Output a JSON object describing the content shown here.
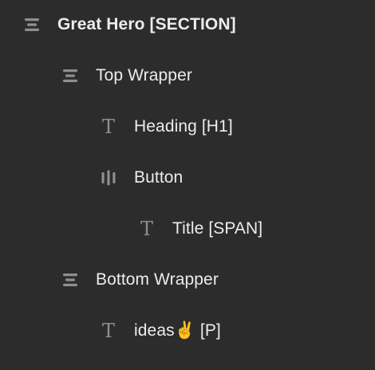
{
  "tree": {
    "items": [
      {
        "label": "Great Hero [SECTION]",
        "icon": "section-stack-icon",
        "level": 0
      },
      {
        "label": "Top Wrapper",
        "icon": "div-stack-icon",
        "level": 1
      },
      {
        "label": "Heading [H1]",
        "icon": "text-icon",
        "level": 2
      },
      {
        "label": "Button",
        "icon": "button-icon",
        "level": 2
      },
      {
        "label": "Title [SPAN]",
        "icon": "text-icon",
        "level": 3
      },
      {
        "label": "Bottom Wrapper",
        "icon": "div-stack-icon",
        "level": 1
      },
      {
        "label": "ideas✌️ [P]",
        "icon": "text-icon",
        "level": 2
      }
    ],
    "text_glyph": "T",
    "colors": {
      "background": "#2c2c2c",
      "text": "#ececec",
      "icon": "#8e8e8e"
    }
  }
}
